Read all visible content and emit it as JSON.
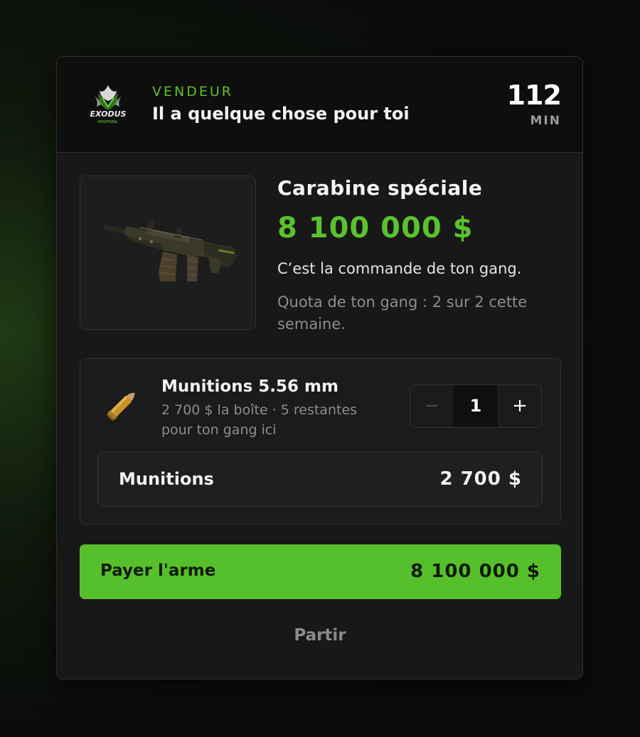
{
  "vendor": {
    "logo_text": "EXODUS",
    "logo_subtext": "MONTREAL",
    "label": "VENDEUR",
    "subtitle": "Il a quelque chose pour toi",
    "timer_value": "112",
    "timer_unit": "MIN"
  },
  "weapon": {
    "name": "Carabine spéciale",
    "price": "8 100 000 $",
    "description": "C’est la commande de ton gang.",
    "quota": "Quota de ton gang : 2 sur 2 cette semaine.",
    "image_icon": "rifle-icon"
  },
  "ammo": {
    "name": "Munitions 5.56 mm",
    "info": "2 700 $ la boîte · 5 restantes pour ton gang ici",
    "icon": "bullet-icon",
    "quantity": "1",
    "minus_label": "−",
    "plus_label": "+",
    "total_label": "Munitions",
    "total_value": "2 700 $"
  },
  "actions": {
    "pay_label": "Payer l'arme",
    "pay_amount": "8 100 000 $",
    "leave_label": "Partir"
  },
  "colors": {
    "accent": "#5ac22e",
    "button": "#56c02c",
    "panel": "#181818",
    "header": "#0e0e0e"
  }
}
